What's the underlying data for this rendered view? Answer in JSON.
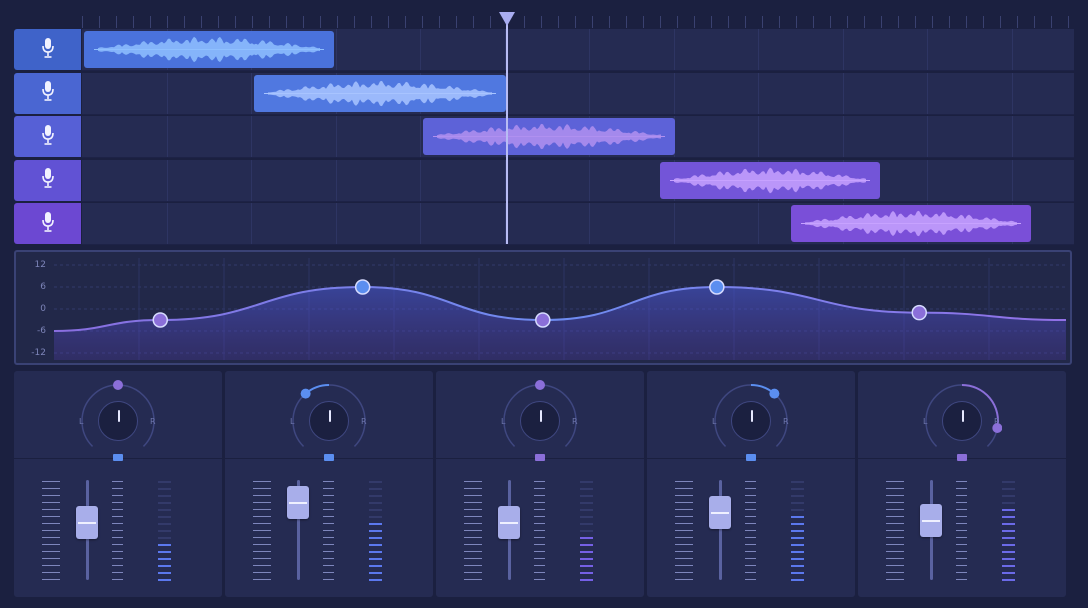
{
  "tracks": [
    {
      "name": "track-1",
      "head_color": "#3f63c9",
      "clip_color": "#4a72dc",
      "wave_color": "#8fc0ff",
      "clip_start": 0,
      "clip_len": 250
    },
    {
      "name": "track-2",
      "head_color": "#4a66d2",
      "clip_color": "#5078e0",
      "wave_color": "#a8c4ff",
      "clip_start": 170,
      "clip_len": 252
    },
    {
      "name": "track-3",
      "head_color": "#5660d6",
      "clip_color": "#5d62d8",
      "wave_color": "#b090f0",
      "clip_start": 339,
      "clip_len": 252
    },
    {
      "name": "track-4",
      "head_color": "#6152d4",
      "clip_color": "#7355d8",
      "wave_color": "#c7a2ff",
      "clip_start": 576,
      "clip_len": 220
    },
    {
      "name": "track-5",
      "head_color": "#6c48d2",
      "clip_color": "#7a4fd8",
      "wave_color": "#c7a2ff",
      "clip_start": 707,
      "clip_len": 240
    }
  ],
  "eq": {
    "labels": [
      "12",
      "6",
      "0",
      "-6",
      "-12"
    ],
    "curve_color": "#7d8cf0",
    "nodes": [
      {
        "x": 0.105,
        "gain": -3,
        "color": "#8b6fd9"
      },
      {
        "x": 0.305,
        "gain": 6,
        "color": "#5b8ef0"
      },
      {
        "x": 0.483,
        "gain": -3,
        "color": "#8b6fd9"
      },
      {
        "x": 0.655,
        "gain": 6,
        "color": "#5b8ef0"
      },
      {
        "x": 0.855,
        "gain": -1,
        "color": "#8b6fd9"
      }
    ]
  },
  "mixer": {
    "pan_left_label": "L",
    "pan_right_label": "R",
    "channels": [
      {
        "name": "channel-1",
        "pan": 0.0,
        "pan_color": "#8b6fd9",
        "led_color": "#5b8ef0",
        "fader": 0.58,
        "meter": 0.42,
        "meter_color": "#5b78ee"
      },
      {
        "name": "channel-2",
        "pan": -0.3,
        "pan_color": "#5b8ef0",
        "led_color": "#5b8ef0",
        "fader": 0.78,
        "meter": 0.62,
        "meter_color": "#5b78ee"
      },
      {
        "name": "channel-3",
        "pan": 0.0,
        "pan_color": "#8b6fd9",
        "led_color": "#8b6fd9",
        "fader": 0.58,
        "meter": 0.48,
        "meter_color": "#7560e6"
      },
      {
        "name": "channel-4",
        "pan": 0.3,
        "pan_color": "#5b8ef0",
        "led_color": "#5b8ef0",
        "fader": 0.68,
        "meter": 0.64,
        "meter_color": "#5b78ee"
      },
      {
        "name": "channel-5",
        "pan": 0.75,
        "pan_color": "#8b6fd9",
        "led_color": "#8b6fd9",
        "fader": 0.6,
        "meter": 0.7,
        "meter_color": "#6b6ae8"
      }
    ]
  }
}
